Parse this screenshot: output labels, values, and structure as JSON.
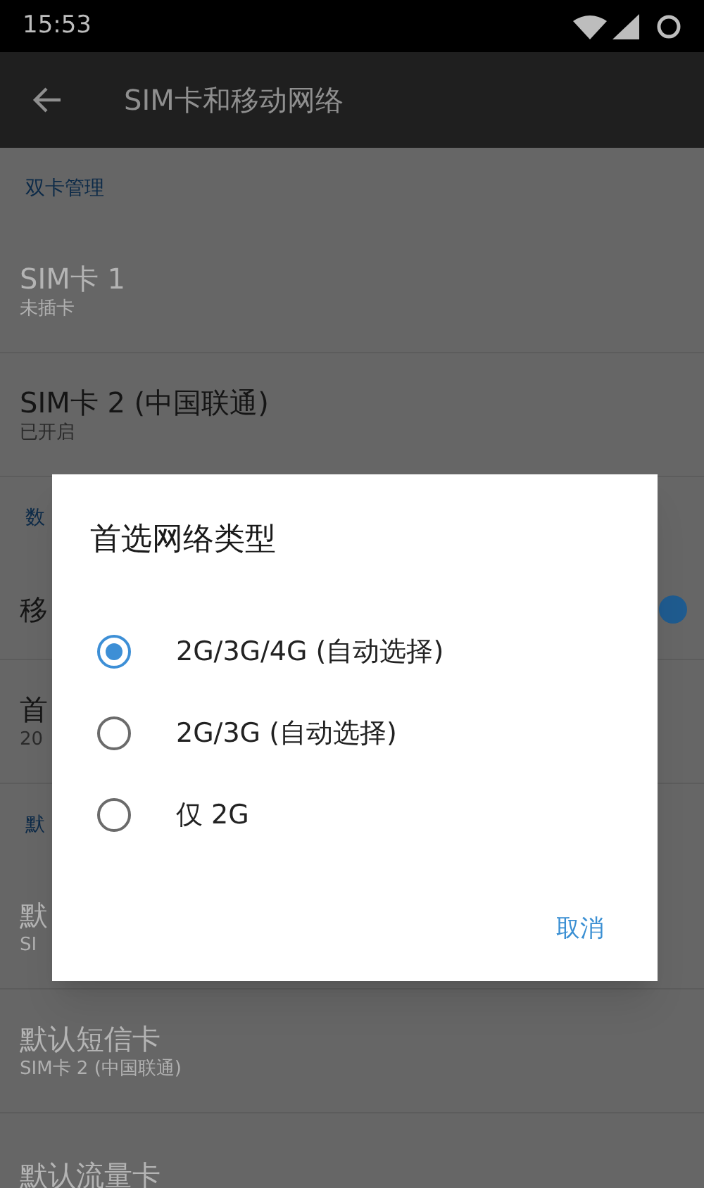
{
  "status_bar": {
    "time": "15:53"
  },
  "toolbar": {
    "title": "SIM卡和移动网络"
  },
  "list": [
    {
      "kind": "header",
      "text": "双卡管理"
    },
    {
      "kind": "item",
      "title": "SIM卡 1",
      "subtitle": "未插卡",
      "disabled": true
    },
    {
      "kind": "item",
      "title": "SIM卡 2 (中国联通)",
      "subtitle": "已开启",
      "disabled": false
    },
    {
      "kind": "header",
      "text": "数"
    },
    {
      "kind": "switch",
      "title": "移",
      "on": true
    },
    {
      "kind": "item",
      "title": "首",
      "subtitle": "20",
      "disabled": false
    },
    {
      "kind": "header",
      "text": "默"
    },
    {
      "kind": "item",
      "title": "默",
      "subtitle": "SI",
      "disabled": true
    },
    {
      "kind": "item",
      "title": "默认短信卡",
      "subtitle": "SIM卡 2 (中国联通)",
      "disabled": true
    },
    {
      "kind": "item",
      "title": "默认流量卡",
      "disabled": true
    }
  ],
  "dialog": {
    "title": "首选网络类型",
    "options": [
      {
        "label": "2G/3G/4G (自动选择)",
        "selected": true
      },
      {
        "label": "2G/3G (自动选择)",
        "selected": false
      },
      {
        "label": "仅 2G",
        "selected": false
      }
    ],
    "buttons": [
      "取消"
    ]
  }
}
